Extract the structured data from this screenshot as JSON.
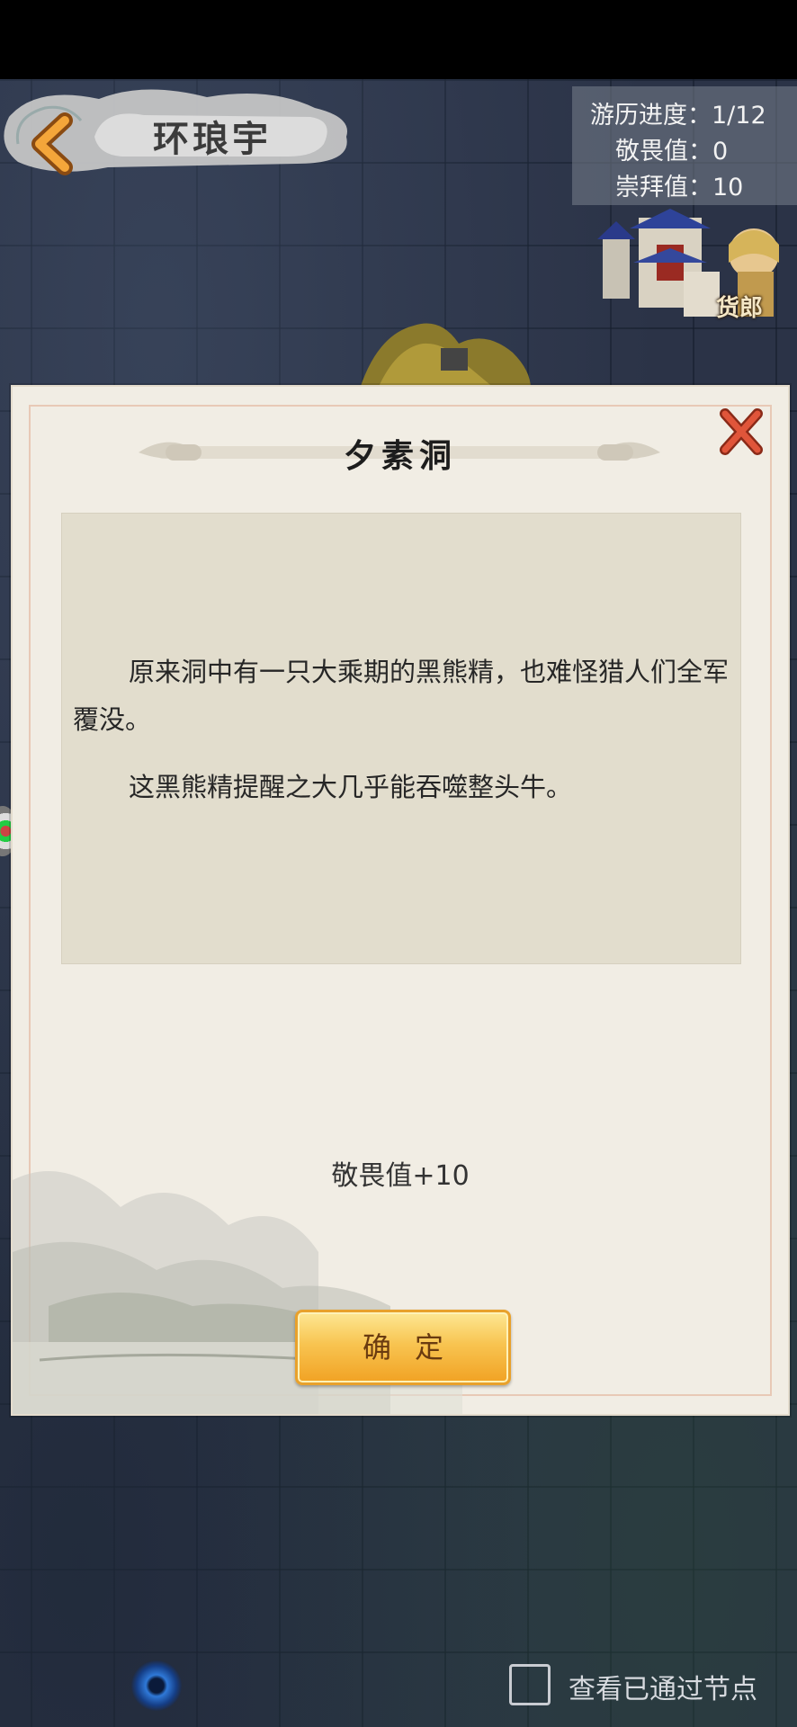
{
  "header": {
    "location_title": "环琅宇"
  },
  "stats": {
    "progress_label": "游历进度：",
    "progress_value": "1/12",
    "awe_label": "敬畏值：",
    "awe_value": "0",
    "worship_label": "崇拜值：",
    "worship_value": "10"
  },
  "shop": {
    "label": "货郎"
  },
  "dialog": {
    "title": "夕素洞",
    "paragraph1": "原来洞中有一只大乘期的黑熊精，也难怪猎人们全军覆没。",
    "paragraph2": "这黑熊精提醒之大几乎能吞噬整头牛。",
    "reward": "敬畏值+10",
    "confirm_label": "确定"
  },
  "footer": {
    "checkbox_label": "查看已通过节点",
    "checkbox_checked": false
  },
  "colors": {
    "confirm_button": "#f8c451",
    "close_icon": "#d8442a",
    "dialog_bg": "#f1ede4",
    "content_box": "#e2ddcd"
  }
}
